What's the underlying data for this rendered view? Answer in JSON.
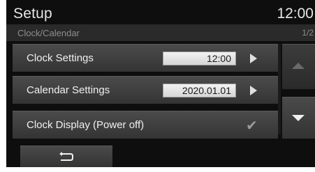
{
  "header": {
    "title": "Setup",
    "time": "12:00"
  },
  "subheader": {
    "title": "Clock/Calendar",
    "page": "1/2"
  },
  "rows": [
    {
      "label": "Clock Settings",
      "value": "12:00",
      "action_icon": "play-arrow-icon"
    },
    {
      "label": "Calendar Settings",
      "value": "2020.01.01",
      "action_icon": "play-arrow-icon"
    },
    {
      "label": "Clock Display (Power off)",
      "checked": true,
      "action_icon": "check-icon"
    }
  ],
  "scroll": {
    "up_icon": "scroll-up-icon",
    "down_icon": "scroll-down-icon"
  },
  "footer": {
    "back_icon": "back-arrow-icon"
  }
}
